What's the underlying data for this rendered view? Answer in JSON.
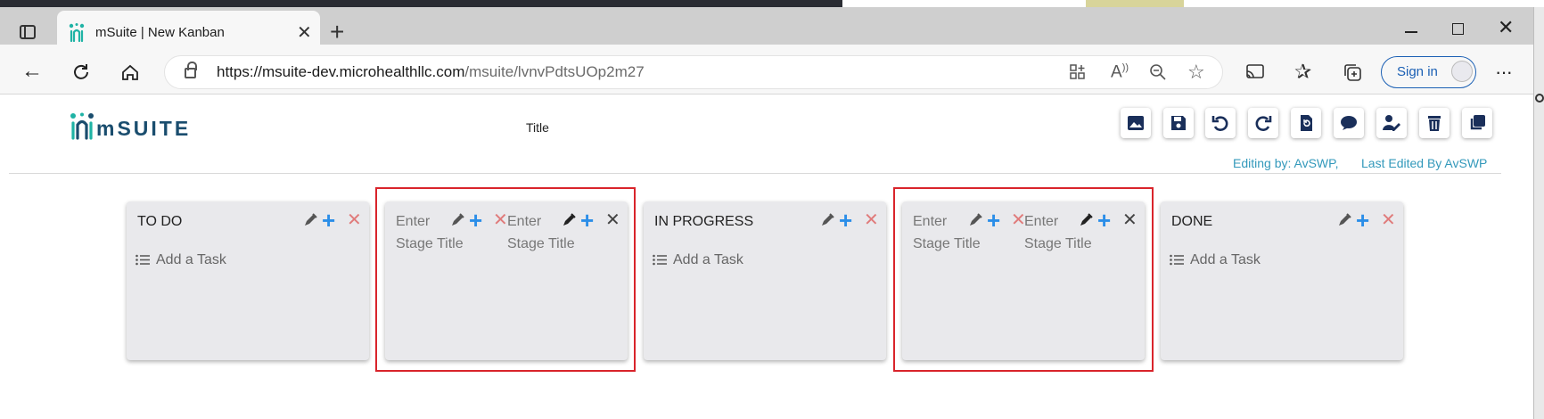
{
  "browser": {
    "tab_title": "mSuite | New Kanban",
    "url_host": "https://msuite-dev.microhealthllc.com",
    "url_path": "/msuite/lvnvPdtsUOp2m27",
    "signin_label": "Sign in"
  },
  "app": {
    "logo_text": "mSUITE",
    "title": "Title",
    "editing_by": "Editing by: AvSWP,",
    "last_edited": "Last Edited By AvSWP",
    "toolbar": [
      "image-icon",
      "save-icon",
      "undo-icon",
      "redo-icon",
      "restore-icon",
      "comment-icon",
      "user-edit-icon",
      "trash-icon",
      "copy-icon"
    ]
  },
  "board": {
    "columns": [
      {
        "title": "TO DO",
        "add_task": "Add a Task"
      },
      {
        "placeholder_1": "Enter",
        "placeholder_2": "Stage Title",
        "placeholder_b1": "Enter",
        "placeholder_b2": "Stage Title"
      },
      {
        "title": "IN PROGRESS",
        "add_task": "Add a Task"
      },
      {
        "placeholder_1": "Enter",
        "placeholder_2": "Stage Title",
        "placeholder_b1": "Enter",
        "placeholder_b2": "Stage Title"
      },
      {
        "title": "DONE",
        "add_task": "Add a Task"
      }
    ],
    "highlight_color": "#d9242b",
    "accent_plus": "#2b8ee8",
    "delete_color": "#e07b7b"
  }
}
